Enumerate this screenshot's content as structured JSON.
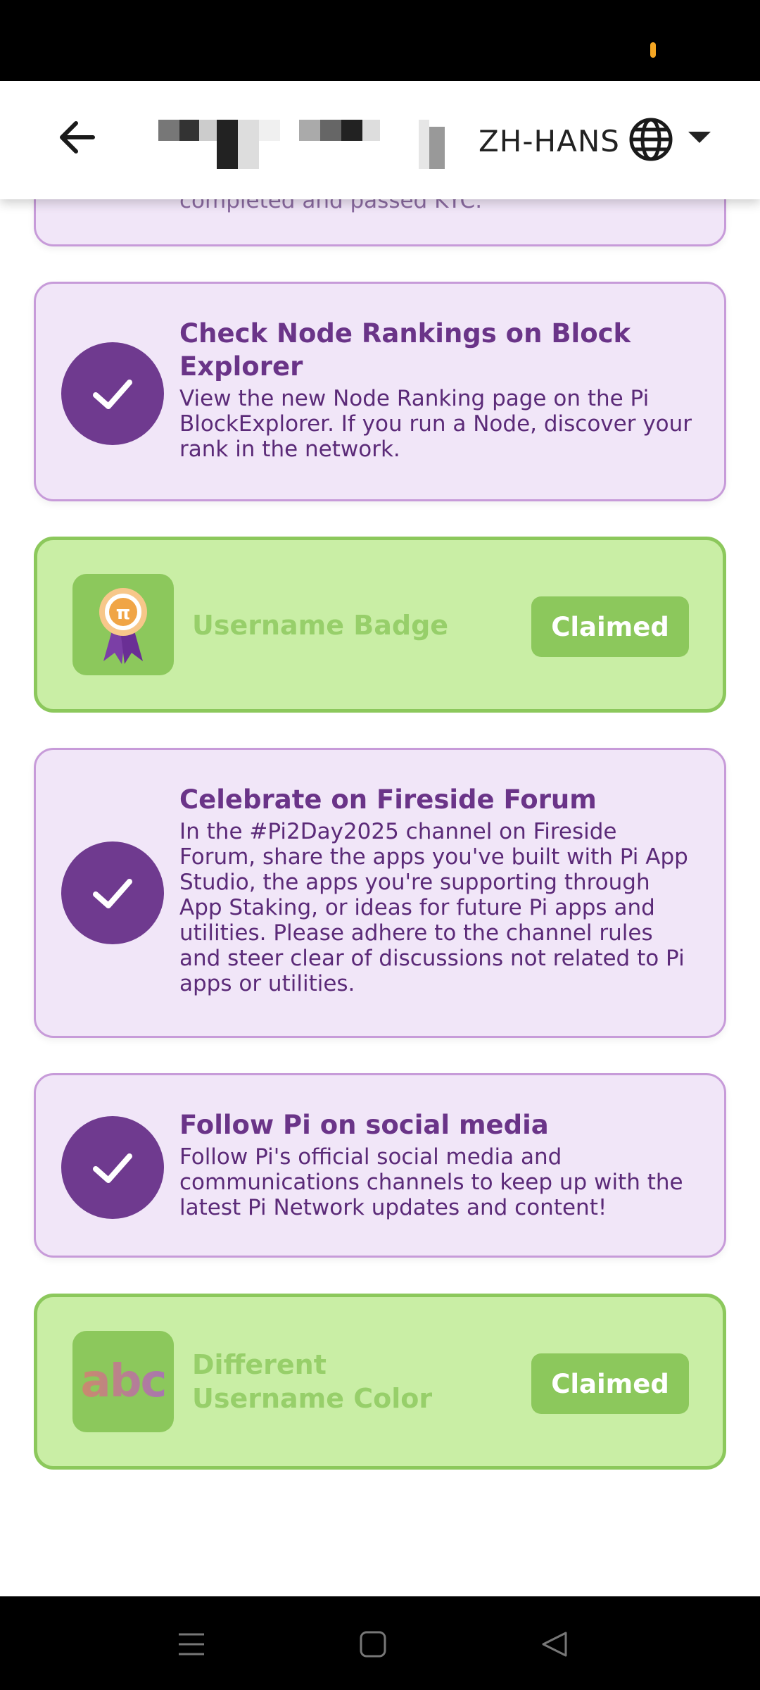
{
  "header": {
    "language": "ZH-HANS"
  },
  "tasks": [
    {
      "title": "",
      "description": "completed and passed KYC.",
      "completed": true
    },
    {
      "title": "Check Node Rankings on Block Explorer",
      "description": "View the new Node Ranking page on the Pi BlockExplorer. If you run a Node, discover your rank in the network.",
      "completed": true
    },
    {
      "title": "Celebrate on Fireside Forum",
      "description": "In the #Pi2Day2025 channel on Fireside Forum, share the apps you've built with Pi App Studio, the apps you're supporting through App Staking, or ideas for future Pi apps and utilities. Please adhere to the channel rules and steer clear of discussions not related to Pi apps or utilities.",
      "completed": true
    },
    {
      "title": "Follow Pi on social media",
      "description": "Follow Pi's official social media and communications channels to keep up with the latest Pi Network updates and content!",
      "completed": true
    }
  ],
  "rewards": [
    {
      "label": "Username Badge",
      "button": "Claimed",
      "icon": "badge-ribbon-icon"
    },
    {
      "label": "Different Username Color",
      "button": "Claimed",
      "icon": "abc-color-icon",
      "icon_text": "abc"
    }
  ],
  "colors": {
    "task_bg": "#f1e6f8",
    "task_border": "#c79bd9",
    "check_circle": "#6f3a8f",
    "reward_bg": "#c9eea5",
    "reward_border": "#8cc85c",
    "claimed_button": "#8cc85c"
  }
}
